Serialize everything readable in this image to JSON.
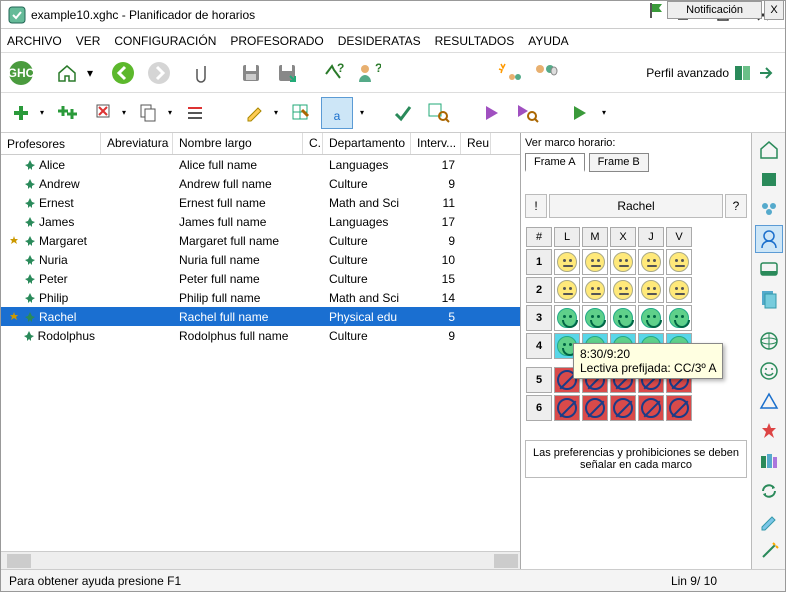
{
  "window": {
    "title": "example10.xghc - Planificador de horarios"
  },
  "menu": [
    "ARCHIVO",
    "VER",
    "CONFIGURACIÓN",
    "PROFESORADO",
    "DESIDERATAS",
    "RESULTADOS",
    "AYUDA"
  ],
  "toolbar1": {
    "perfil_label": "Perfil avanzado"
  },
  "notif": {
    "label": "Notificación",
    "x": "X"
  },
  "columns": {
    "profesores": "Profesores",
    "abrev": "Abreviatura",
    "nombre": "Nombre largo",
    "c": "C...",
    "dep": "Departamento",
    "interv": "Interv...",
    "reu": "Reu"
  },
  "rows": [
    {
      "pin": true,
      "name": "Alice",
      "full": "Alice full name",
      "dep": "Languages",
      "int": "17"
    },
    {
      "pin": true,
      "name": "Andrew",
      "full": "Andrew full name",
      "dep": "Culture",
      "int": "9"
    },
    {
      "pin": true,
      "name": "Ernest",
      "full": "Ernest full name",
      "dep": "Math and Sci",
      "int": "11"
    },
    {
      "pin": true,
      "name": "James",
      "full": "James full name",
      "dep": "Languages",
      "int": "17"
    },
    {
      "pin": true,
      "star": true,
      "name": "Margaret",
      "full": "Margaret full name",
      "dep": "Culture",
      "int": "9"
    },
    {
      "pin": true,
      "name": "Nuria",
      "full": "Nuria full name",
      "dep": "Culture",
      "int": "10"
    },
    {
      "pin": true,
      "name": "Peter",
      "full": "Peter full name",
      "dep": "Culture",
      "int": "15"
    },
    {
      "pin": true,
      "name": "Philip",
      "full": "Philip full name",
      "dep": "Math and Sci",
      "int": "14"
    },
    {
      "pin": true,
      "star": true,
      "name": "Rachel",
      "full": "Rachel full name",
      "dep": "Physical edu",
      "int": "5",
      "selected": true
    },
    {
      "pin": true,
      "name": "Rodolphus",
      "full": "Rodolphus full name",
      "dep": "Culture",
      "int": "9"
    }
  ],
  "right": {
    "marco_label": "Ver marco horario:",
    "frames": [
      "Frame A",
      "Frame B"
    ],
    "active_frame": 0,
    "who": "Rachel",
    "bang": "!",
    "q": "?",
    "hash": "#",
    "days": [
      "L",
      "M",
      "X",
      "J",
      "V"
    ],
    "periods": [
      "1",
      "2",
      "3",
      "4",
      "5",
      "6"
    ],
    "cells": [
      [
        "y",
        "y",
        "y",
        "y",
        "y"
      ],
      [
        "y",
        "y",
        "y",
        "y",
        "y"
      ],
      [
        "g",
        "g",
        "g",
        "g",
        "g"
      ],
      [
        "gc",
        "gc",
        "gc",
        "gc",
        "gc"
      ],
      [
        "f",
        "f",
        "f",
        "f",
        "f"
      ],
      [
        "f",
        "f",
        "f",
        "f",
        "f"
      ]
    ],
    "tooltip_l1": "8:30/9:20",
    "tooltip_l2": "Lectiva prefijada: CC/3º A",
    "prefs": "Las preferencias y prohibiciones se deben señalar en cada marco"
  },
  "status": {
    "help": "Para obtener ayuda presione F1",
    "pos": "Lin 9/ 10"
  }
}
